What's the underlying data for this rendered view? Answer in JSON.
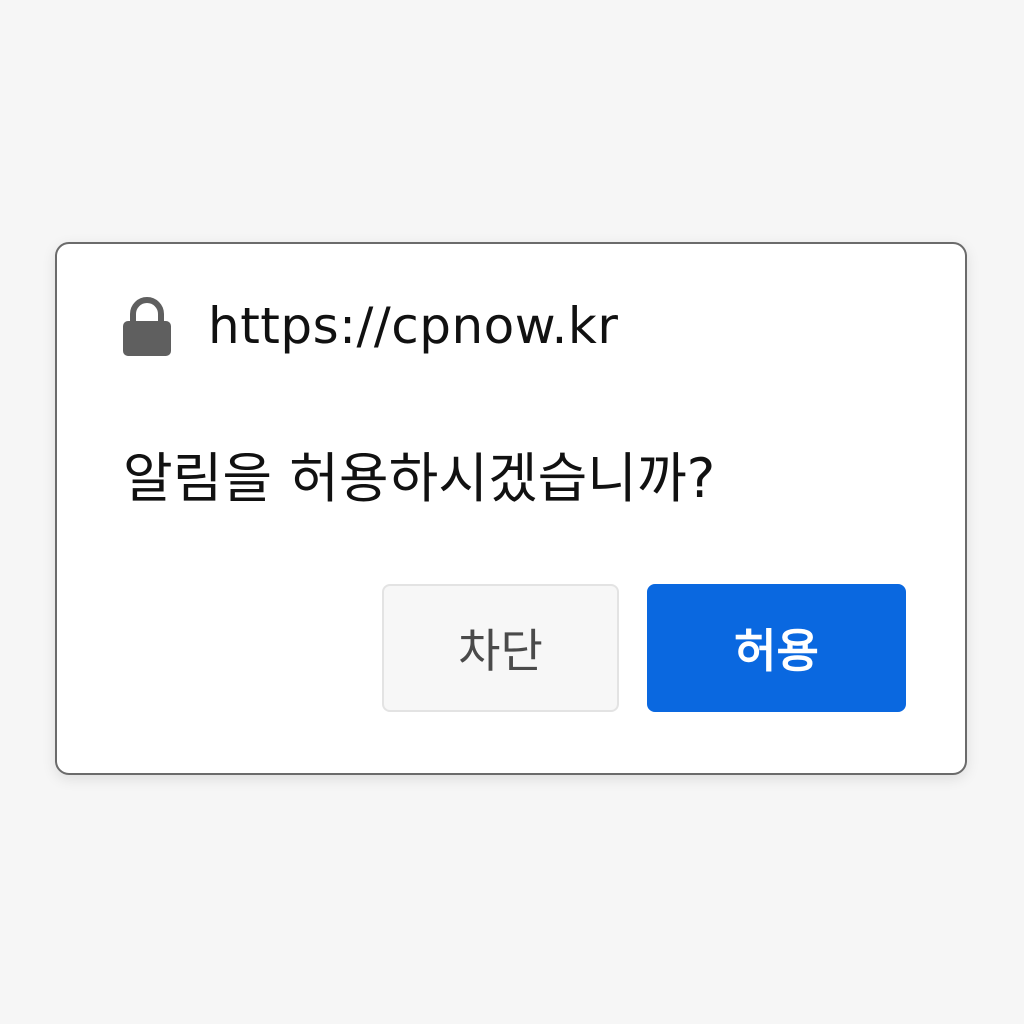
{
  "prompt": {
    "origin": "https://cpnow.kr",
    "origin_icon": "lock-icon",
    "message": "알림을 허용하시겠습니까?",
    "buttons": {
      "block_label": "차단",
      "allow_label": "허용"
    }
  },
  "colors": {
    "page_background": "#f6f6f6",
    "dialog_background": "#ffffff",
    "dialog_border": "#6b6b6b",
    "lock_icon": "#5f5f5f",
    "block_button_background": "#f7f7f7",
    "allow_button_background": "#0a68e0",
    "allow_button_text": "#ffffff"
  }
}
